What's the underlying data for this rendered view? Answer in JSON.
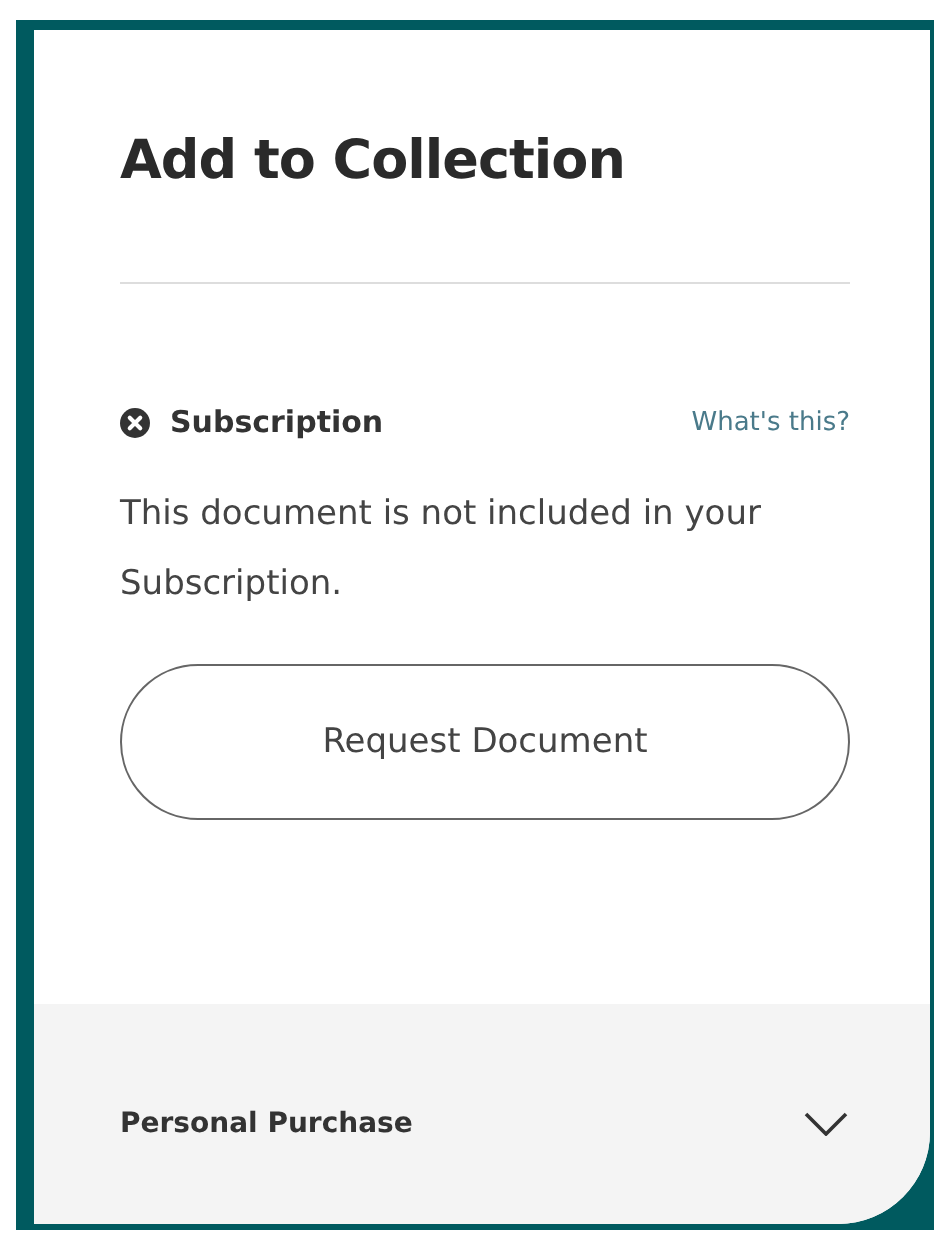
{
  "panel": {
    "title": "Add to Collection"
  },
  "subscription": {
    "label": "Subscription",
    "included": false,
    "help_link": "What's this?",
    "message": "This document is not included in your Subscription.",
    "button": "Request Document"
  },
  "personal_purchase": {
    "label": "Personal Purchase",
    "expanded": false
  }
}
